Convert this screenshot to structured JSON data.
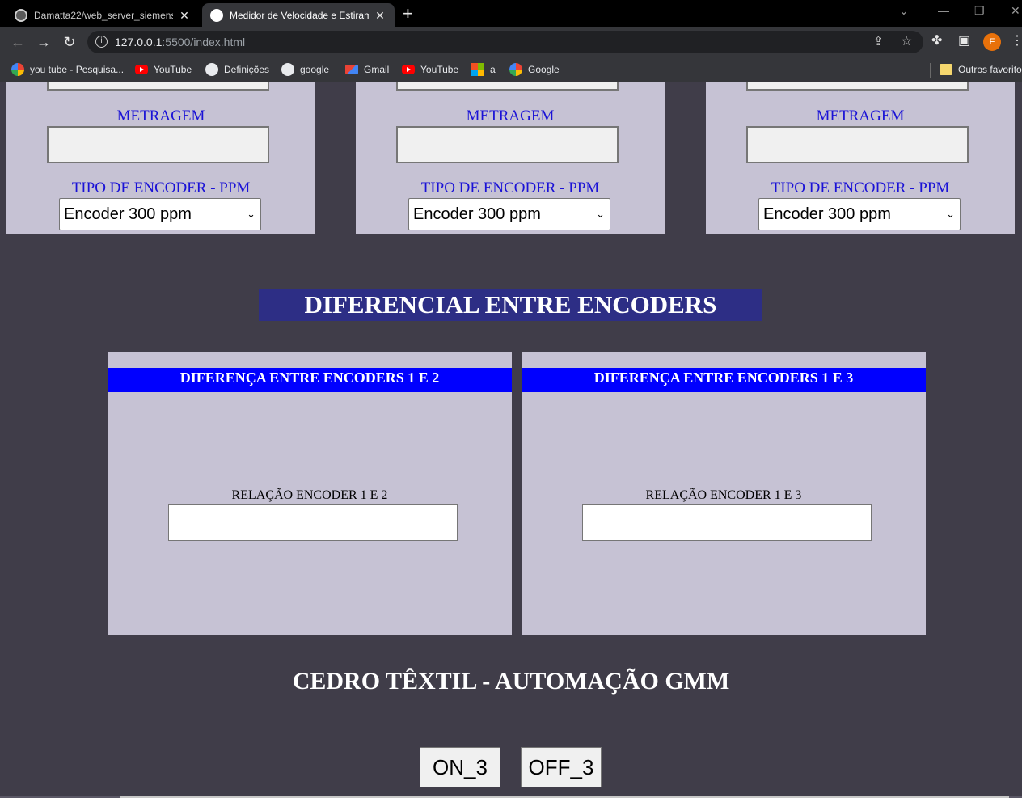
{
  "browser": {
    "tabs": [
      {
        "title": "Damatta22/web_server_siemens:",
        "active": false
      },
      {
        "title": "Medidor de Velocidade e Estiram",
        "active": true
      }
    ],
    "url_host": "127.0.0.1",
    "url_rest": ":5500/index.html",
    "bookmarks": [
      {
        "label": "you tube - Pesquisa...",
        "icon": "google-icon"
      },
      {
        "label": "YouTube",
        "icon": "youtube-icon"
      },
      {
        "label": "Definições",
        "icon": "gear-icon"
      },
      {
        "label": "google",
        "icon": "globe-icon"
      },
      {
        "label": "Gmail",
        "icon": "gmail-icon"
      },
      {
        "label": "YouTube",
        "icon": "youtube-icon"
      },
      {
        "label": "a",
        "icon": "microsoft-icon"
      },
      {
        "label": "Google",
        "icon": "google-icon"
      }
    ],
    "other_bookmarks": "Outros favoritos",
    "profile_initial": "F"
  },
  "encoders": [
    {
      "metragem_label": "METRAGEM",
      "metragem_value": "",
      "tipo_label": "TIPO DE ENCODER - PPM",
      "tipo_selected": "Encoder 300 ppm"
    },
    {
      "metragem_label": "METRAGEM",
      "metragem_value": "",
      "tipo_label": "TIPO DE ENCODER - PPM",
      "tipo_selected": "Encoder 300 ppm"
    },
    {
      "metragem_label": "METRAGEM",
      "metragem_value": "",
      "tipo_label": "TIPO DE ENCODER - PPM",
      "tipo_selected": "Encoder 300 ppm"
    }
  ],
  "diferencial": {
    "title": "DIFERENCIAL ENTRE ENCODERS",
    "panels": [
      {
        "heading": "DIFERENÇA ENTRE ENCODERS 1 E 2",
        "relacao_label": "RELAÇÃO ENCODER 1 E 2",
        "relacao_value": ""
      },
      {
        "heading": "DIFERENÇA ENTRE ENCODERS 1 E 3",
        "relacao_label": "RELAÇÃO ENCODER 1 E 3",
        "relacao_value": ""
      }
    ]
  },
  "footer": {
    "company": "CEDRO TÊXTIL - AUTOMAÇÃO GMM",
    "on_button": "ON_3",
    "off_button": "OFF_3"
  },
  "colors": {
    "page_bg": "#403d49",
    "panel_bg": "#c6c2d4",
    "label_blue": "#1a12d6",
    "title_bar": "#2d2e85",
    "heading_bar": "#0000ff"
  }
}
